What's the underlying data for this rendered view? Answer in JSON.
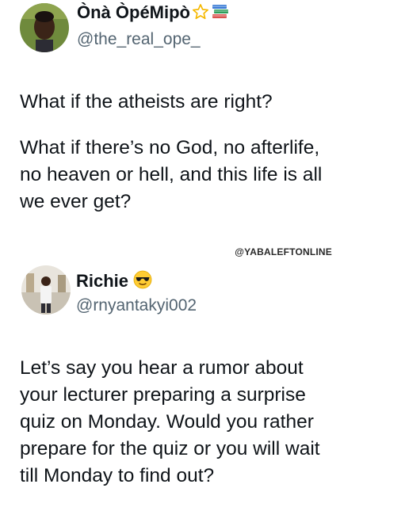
{
  "tweet1": {
    "display_name": "Ònà ÒpéMipò",
    "name_emojis": [
      "star-icon",
      "books-icon"
    ],
    "handle": "@the_real_ope_",
    "paragraph1": "What if the atheists are right?",
    "paragraph2_lines": [
      "What if there’s no God, no afterlife,",
      "no heaven or hell, and this life is all",
      "we ever get?"
    ]
  },
  "watermark": "@YABALEFTONLINE",
  "tweet2": {
    "display_name": "Richie",
    "name_emojis": [
      "sunglasses-emoji-icon"
    ],
    "handle": "@rnyantakyi002",
    "body_lines": [
      "Let’s say you hear a rumor about",
      "your lecturer preparing a surprise",
      "quiz on Monday. Would you rather",
      "prepare for the quiz or you will wait",
      "till Monday to find out?"
    ]
  },
  "colors": {
    "text": "#0f1419",
    "handle": "#536471",
    "star": "#f5b800",
    "emoji_face": "#ffcc33"
  }
}
